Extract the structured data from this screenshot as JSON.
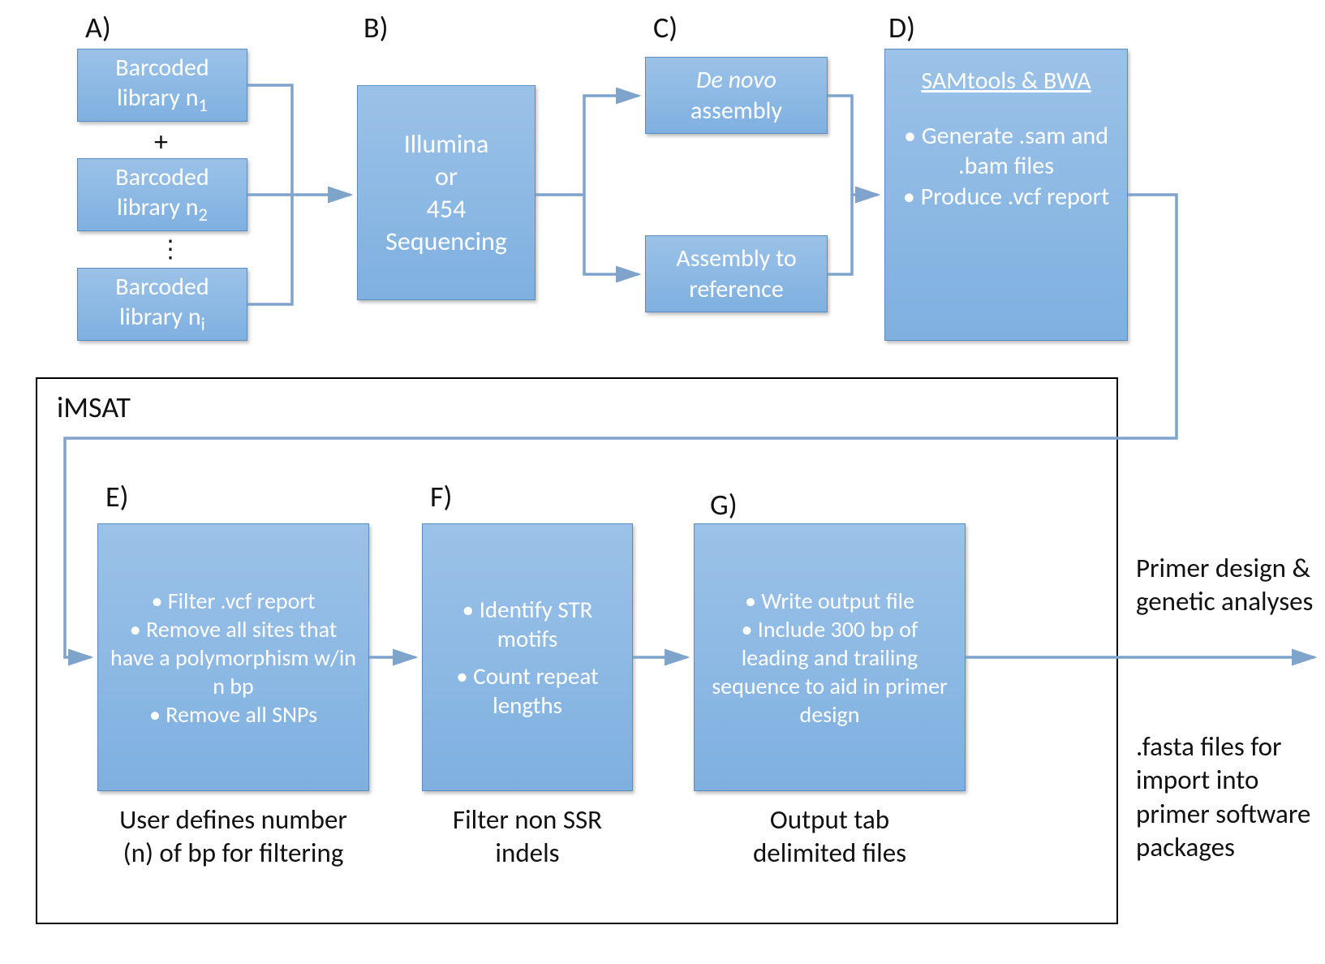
{
  "labels": {
    "A": "A)",
    "B": "B)",
    "C": "C)",
    "D": "D)",
    "E": "E)",
    "F": "F)",
    "G": "G)",
    "iMSAT": "iMSAT"
  },
  "boxA1": {
    "l1": "Barcoded",
    "l2": "library n",
    "sub": "1"
  },
  "boxA2": {
    "l1": "Barcoded",
    "l2": "library n",
    "sub": "2"
  },
  "boxA3": {
    "l1": "Barcoded",
    "l2": "library n",
    "sub": "i"
  },
  "plus": "+",
  "vdots": "⋮",
  "boxB": {
    "l1": "Illumina",
    "l2": "or",
    "l3": "454",
    "l4": "Sequencing"
  },
  "boxC1": {
    "l1_em": "De novo",
    "l2": "assembly"
  },
  "boxC2": {
    "l1": "Assembly to",
    "l2": "reference"
  },
  "boxD": {
    "title": "SAMtools & BWA",
    "b1": "Generate .sam and .bam files",
    "b2": "Produce .vcf report"
  },
  "boxE": {
    "b1": "Filter .vcf report",
    "b2": "Remove all sites that have a polymorphism w/in n bp",
    "b3": "Remove all SNPs"
  },
  "boxF": {
    "b1": "Identify STR motifs",
    "b2": "Count repeat lengths"
  },
  "boxG": {
    "b1": "Write output file",
    "b2": "Include 300 bp of leading and trailing sequence to aid in primer design"
  },
  "captionE": {
    "l1": "User defines number",
    "l2": "(n) of bp for filtering"
  },
  "captionF": {
    "l1": "Filter non SSR",
    "l2": "indels"
  },
  "captionG": {
    "l1": "Output tab",
    "l2": "delimited files"
  },
  "right1": {
    "l1": "Primer design &",
    "l2": "genetic analyses"
  },
  "right2": {
    "l1": ".fasta files for",
    "l2": "import into",
    "l3": "primer software",
    "l4": "packages"
  }
}
